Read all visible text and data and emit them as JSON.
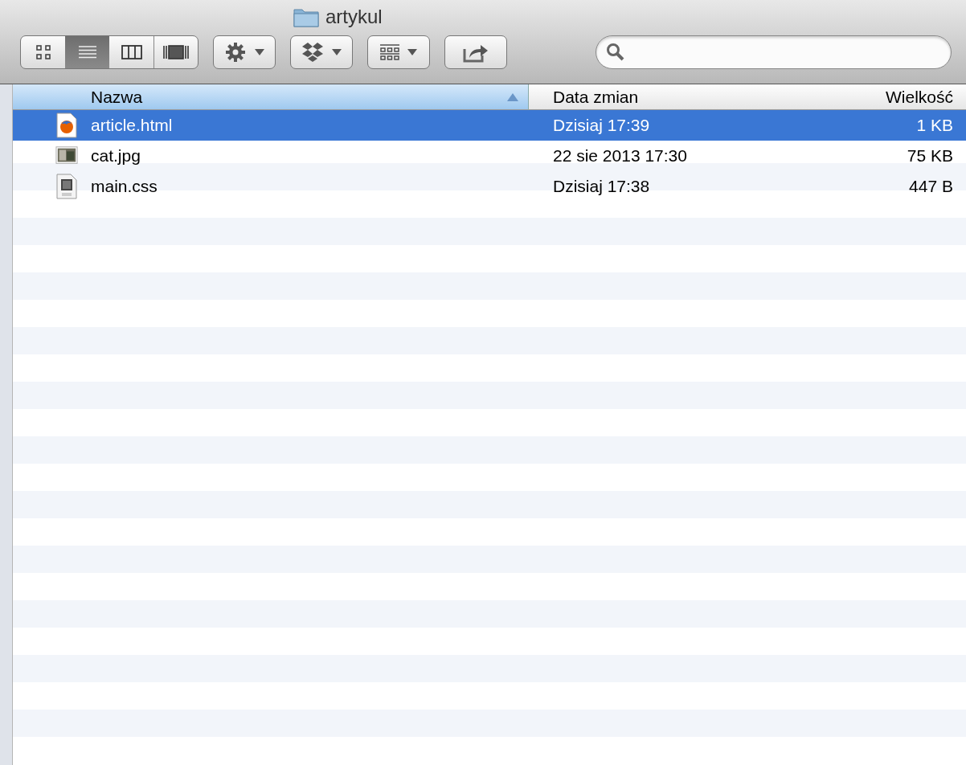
{
  "window": {
    "title": "artykul"
  },
  "view_modes": [
    {
      "kind": "icons",
      "selected": false
    },
    {
      "kind": "list",
      "selected": true
    },
    {
      "kind": "columns",
      "selected": false
    },
    {
      "kind": "coverflow",
      "selected": false
    }
  ],
  "table": {
    "columns": [
      {
        "label": "Nazwa",
        "sorted": true
      },
      {
        "label": "Data zmian",
        "sorted": false
      },
      {
        "label": "Wielkość",
        "sorted": false
      }
    ],
    "rows": [
      {
        "kind": "html",
        "name": "article.html",
        "date": "Dzisiaj 17:39",
        "size": "1 KB",
        "selected": true
      },
      {
        "kind": "image",
        "name": "cat.jpg",
        "date": "22 sie 2013 17:30",
        "size": "75 KB",
        "selected": false
      },
      {
        "kind": "css",
        "name": "main.css",
        "date": "Dzisiaj 17:38",
        "size": "447 B",
        "selected": false
      }
    ]
  }
}
